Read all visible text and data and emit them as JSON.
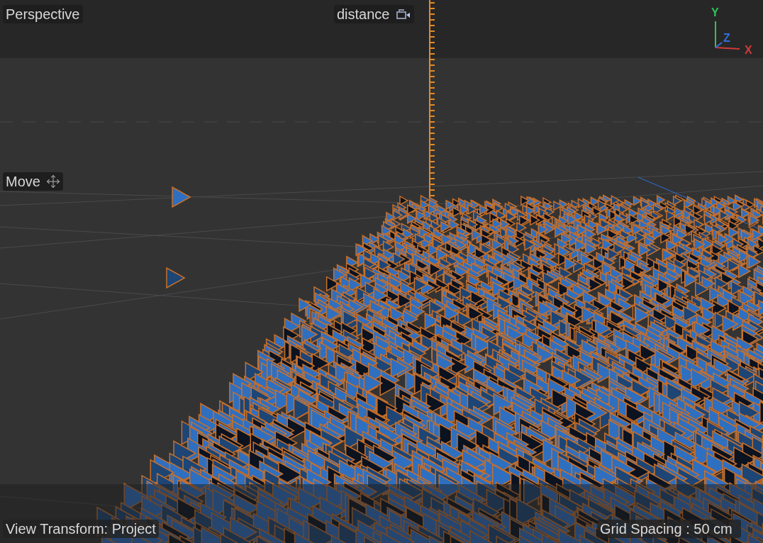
{
  "viewport": {
    "camera_label": "Perspective",
    "focus_label": "distance",
    "tool_label": "Move",
    "axes": [
      {
        "label": "Y",
        "color": "#2fc45a"
      },
      {
        "label": "Z",
        "color": "#2f6fd8"
      },
      {
        "label": "X",
        "color": "#d03a3a"
      }
    ],
    "view_transform": "View Transform: Project",
    "grid_spacing": "Grid Spacing : 50 cm"
  }
}
